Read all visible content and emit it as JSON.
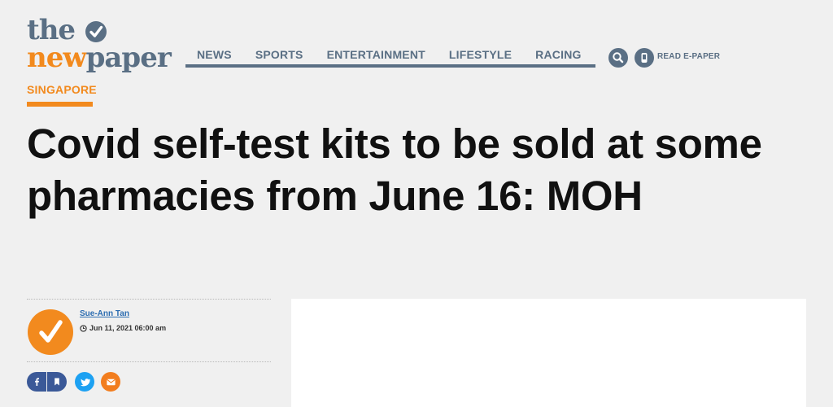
{
  "logo": {
    "line1": "the",
    "line2_a": "new",
    "line2_b": "paper"
  },
  "nav": {
    "items": [
      "NEWS",
      "SPORTS",
      "ENTERTAINMENT",
      "LIFESTYLE",
      "RACING"
    ],
    "read_epaper": "READ E-PAPER"
  },
  "section": "SINGAPORE",
  "headline": "Covid self-test kits to be sold at some pharmacies from June 16: MOH",
  "author": {
    "name": "Sue-Ann Tan",
    "date": "Jun 11, 2021 06:00 am"
  },
  "colors": {
    "brand_orange": "#f28a1e",
    "brand_slate": "#5a6f84",
    "facebook": "#3b5998",
    "twitter": "#1da1f2",
    "email": "#f27d1e"
  },
  "share": {
    "icons": [
      "facebook-icon",
      "bookmark-icon",
      "twitter-icon",
      "email-icon"
    ]
  }
}
